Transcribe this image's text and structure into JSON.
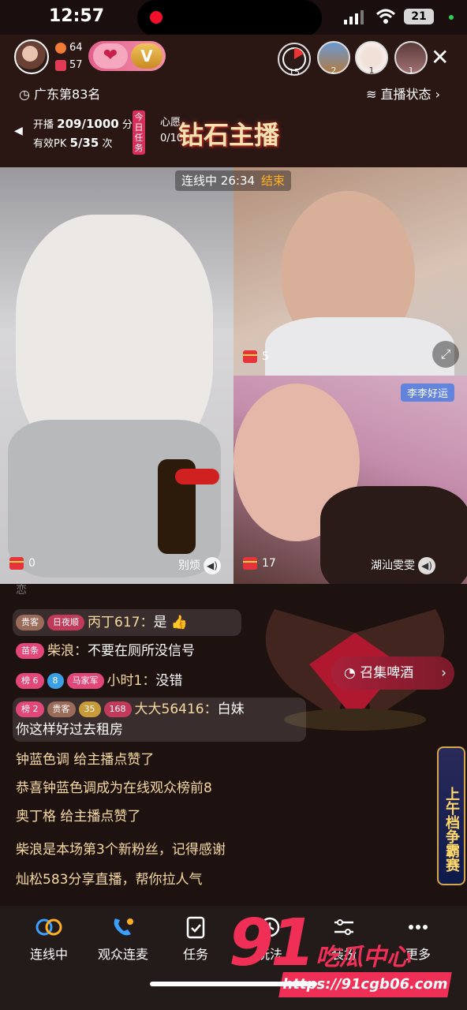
{
  "status_bar": {
    "time": "12:57",
    "battery": "21"
  },
  "header": {
    "stat_fans": "64",
    "stat_reviews": "57",
    "viewer_badges": [
      {
        "name": "timer-15",
        "count": "15"
      },
      {
        "name": "viewer-1",
        "count": "2"
      },
      {
        "name": "viewer-2",
        "count": "1"
      },
      {
        "name": "viewer-3",
        "count": "1"
      }
    ],
    "rank": "广东第83名",
    "live_status": "直播状态"
  },
  "task": {
    "line1_label": "开播",
    "line1_value": "209/1000",
    "line1_unit": "分钟",
    "line2_label": "有效PK",
    "line2_value": "5/35",
    "line2_unit": "次",
    "today_tag": "今日任务",
    "wish_label": "心愿",
    "wish_value": "0/10",
    "banner": "钻石主播"
  },
  "video": {
    "link_timer_label": "连线中",
    "link_timer_value": "26:34",
    "end_label": "结束",
    "main_gift": "0",
    "main_label": "别烦",
    "tr_gift": "5",
    "br_gift": "17",
    "br_name_tag": "李李好运",
    "br_label": "湖汕雯雯"
  },
  "chat": {
    "partial_top": "恋",
    "messages": [
      {
        "badges": [
          "贵客",
          "日夜顺"
        ],
        "name": "丙丁617：",
        "text": "是 👍"
      },
      {
        "badges": [
          "苗条"
        ],
        "name": "柴浪：",
        "text": "不要在厕所没信号"
      },
      {
        "badges": [
          "榜 6",
          "8",
          "马家军"
        ],
        "name": "小时1：",
        "text": "没错"
      },
      {
        "badges": [
          "榜 2",
          "贵客",
          "35",
          "168"
        ],
        "name": "大大56416：",
        "text": "白妹",
        "text2": "你这样好过去租房"
      }
    ],
    "system": [
      "钟蓝色调 给主播点赞了",
      "恭喜钟蓝色调成为在线观众榜前8",
      "奥丁格 给主播点赞了",
      "柴浪是本场第3个新粉丝，记得感谢",
      "灿松583分享直播，帮你拉人气"
    ],
    "beer_button": "召集啤酒",
    "side_banner": "上午档争霸赛"
  },
  "bottom_nav": [
    {
      "label": "连线中"
    },
    {
      "label": "观众连麦"
    },
    {
      "label": "任务"
    },
    {
      "label": "玩法"
    },
    {
      "label": "装扮"
    },
    {
      "label": "更多"
    }
  ],
  "watermark": {
    "num": "91",
    "cn": "吃瓜中心",
    "url": "https://91cgb06.com"
  }
}
